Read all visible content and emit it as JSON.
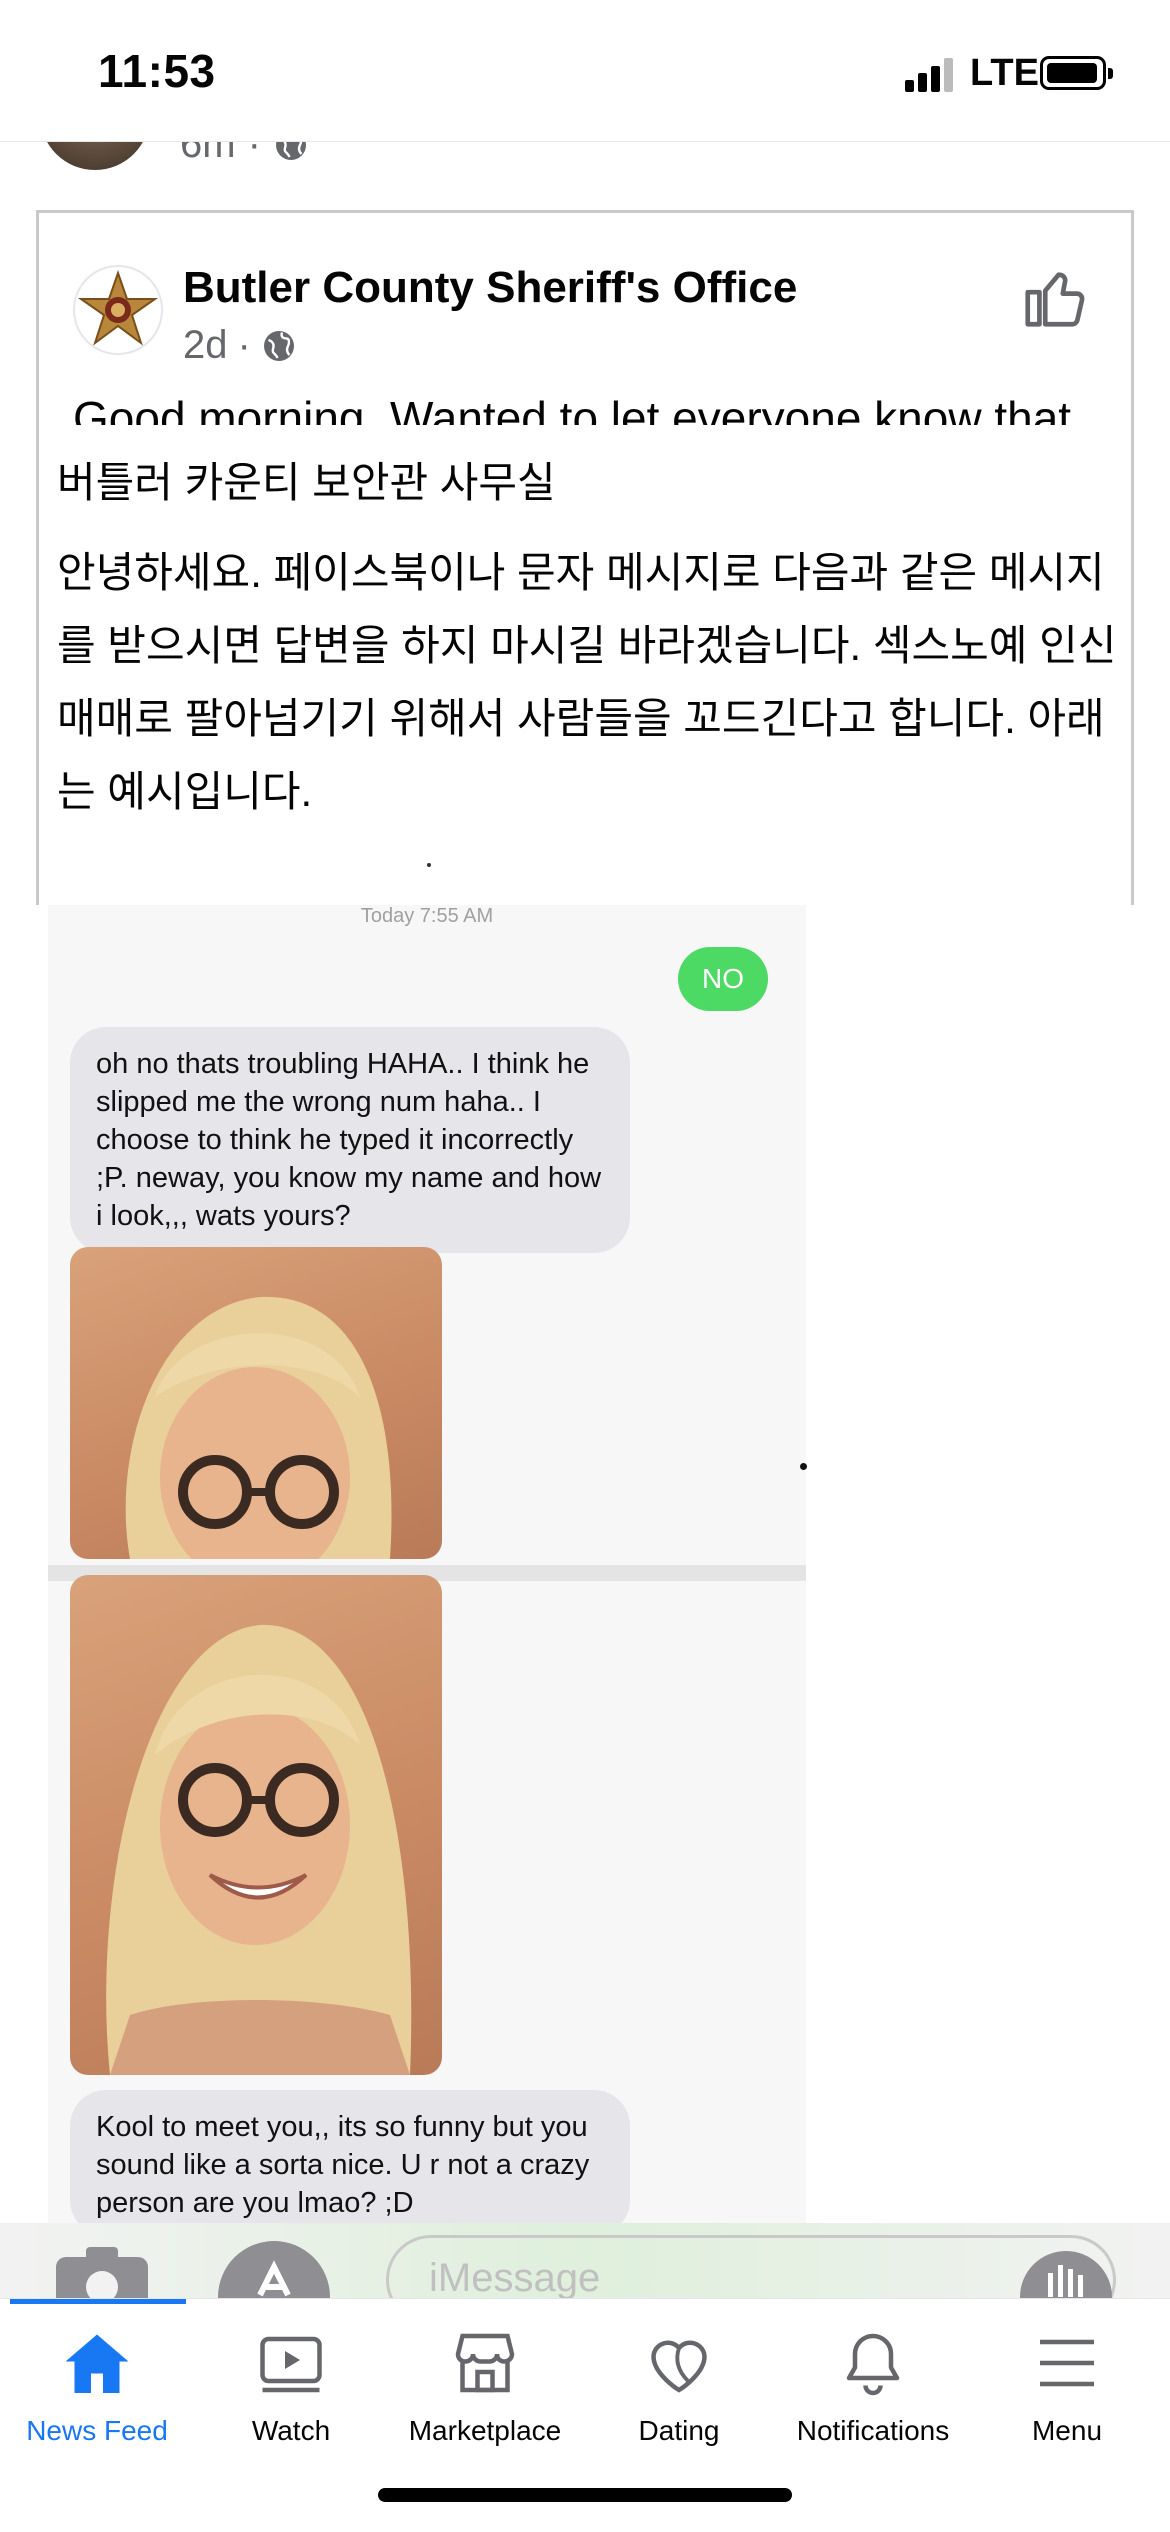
{
  "status_bar": {
    "time": "11:53",
    "network": "LTE"
  },
  "previous_post": {
    "time": "6m"
  },
  "shared_post": {
    "page_name": "Butler County Sheriff's Office",
    "time": "2d",
    "original_text": "Good morning. Wanted to let everyone know that",
    "translation_title": "버틀러 카운티 보안관 사무실",
    "translation_body": "안녕하세요. 페이스북이나 문자 메시지로 다음과 같은 메시지를 받으시면 답변을 하지 마시길 바라겠습니다. 섹스노예 인신매매로 팔아넘기기 위해서 사람들을 꼬드긴다고 합니다. 아래는 예시입니다."
  },
  "message_screenshot": {
    "timestamp": "Today 7:55 AM",
    "outgoing": "NO",
    "incoming_1": "oh no thats troubling HAHA.. I think he slipped me the wrong num haha.. I choose to think he typed it incorrectly ;P. neway, you know my name and how i look,,, wats yours?",
    "incoming_2": "Kool to meet you,, its so funny but you sound like a sorta nice. U r not a crazy person are you lmao? ;D",
    "input_placeholder": "iMessage"
  },
  "bottom_nav": {
    "items": [
      {
        "label": "News Feed",
        "icon": "home-icon",
        "active": true
      },
      {
        "label": "Watch",
        "icon": "watch-icon"
      },
      {
        "label": "Marketplace",
        "icon": "marketplace-icon"
      },
      {
        "label": "Dating",
        "icon": "dating-icon"
      },
      {
        "label": "Notifications",
        "icon": "bell-icon"
      },
      {
        "label": "Menu",
        "icon": "menu-icon"
      }
    ]
  },
  "colors": {
    "accent": "#1877f2",
    "imessage_green": "#4cd964",
    "meta_gray": "#65676b"
  }
}
